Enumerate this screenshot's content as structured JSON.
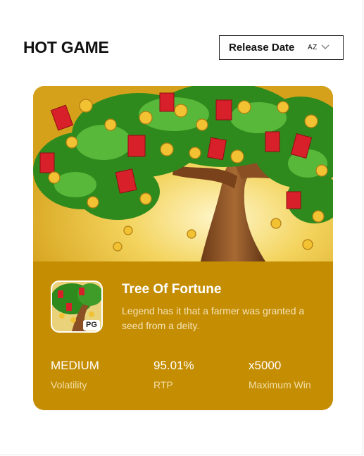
{
  "header": {
    "title": "HOT GAME",
    "sort": {
      "label": "Release Date",
      "order_badge": "AZ",
      "icon": "chevron-down-icon"
    }
  },
  "game": {
    "title": "Tree Of Fortune",
    "description": "Legend has it that a farmer was granted a seed from a deity.",
    "icon_badge": "PG",
    "accent_color": "#c58d02",
    "stats": [
      {
        "value": "MEDIUM",
        "label": "Volatility"
      },
      {
        "value": "95.01%",
        "label": "RTP"
      },
      {
        "value": "x5000",
        "label": "Maximum Win"
      }
    ]
  }
}
